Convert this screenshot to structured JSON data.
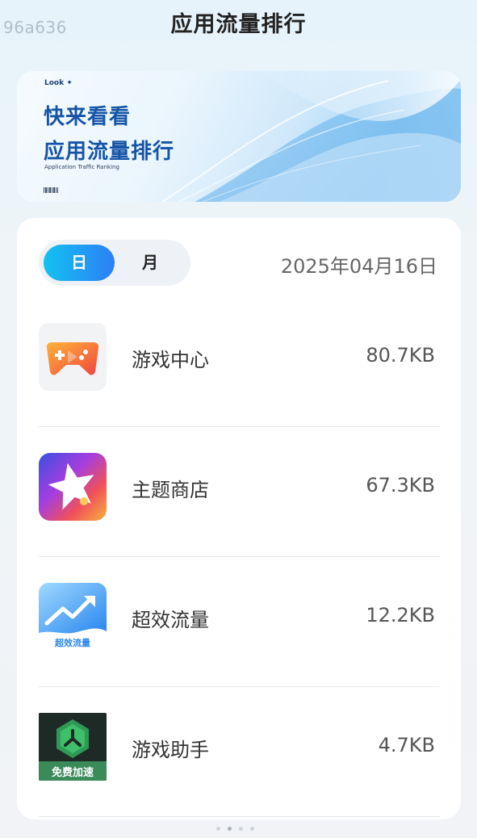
{
  "watermark": "96a636",
  "page_title": "应用流量排行",
  "banner": {
    "look": "Look ✦",
    "headline_1": "快来看看",
    "headline_2": "应用流量排行",
    "subtitle": "Application Traffic Ranking"
  },
  "toggle": {
    "day": "日",
    "month": "月",
    "selected": "日"
  },
  "date": "2025年04月16日",
  "apps": [
    {
      "name": "游戏中心",
      "size": "80.7KB",
      "icon": "game-center-icon"
    },
    {
      "name": "主题商店",
      "size": "67.3KB",
      "icon": "theme-store-icon"
    },
    {
      "name": "超效流量",
      "size": "12.2KB",
      "icon": "super-traffic-icon",
      "icon_text": "超效流量"
    },
    {
      "name": "游戏助手",
      "size": "4.7KB",
      "icon": "game-assistant-icon",
      "icon_text": "免费加速"
    }
  ],
  "pager": {
    "count": 4,
    "active_index": 1
  },
  "colors": {
    "accent_start": "#12c2f2",
    "accent_end": "#2d7ff6",
    "banner_text": "#1554a6"
  }
}
